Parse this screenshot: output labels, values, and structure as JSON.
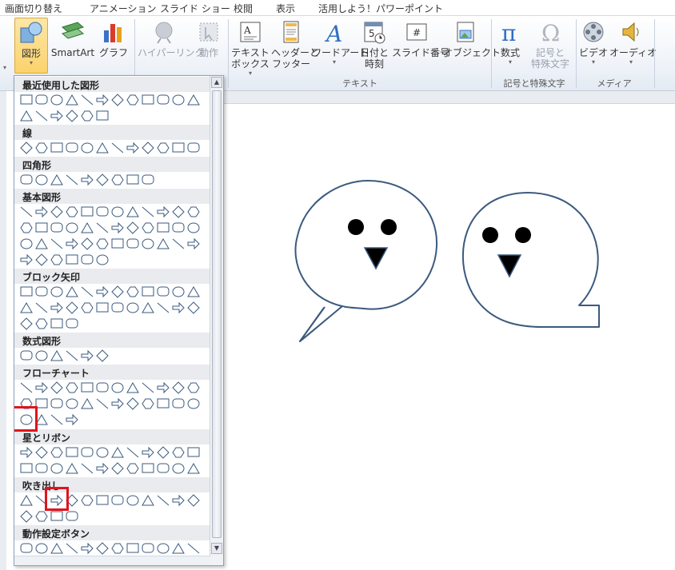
{
  "tabs": [
    "画面切り替え",
    "アニメーション",
    "スライド ショー",
    "校閲",
    "表示",
    "活用しよう！パワーポイント"
  ],
  "ribbon": {
    "buttons": [
      {
        "label": "図形",
        "icon": "shapes-icon",
        "active": true,
        "caret": true
      },
      {
        "label": "SmartArt",
        "icon": "smartart-icon"
      },
      {
        "label": "グラフ",
        "icon": "chart-icon"
      },
      {
        "label": "ハイパーリンク",
        "icon": "hyperlink-icon",
        "disabled": true
      },
      {
        "label": "動作",
        "icon": "action-icon",
        "disabled": true
      },
      {
        "label": "テキスト\nボックス",
        "icon": "textbox-icon",
        "caret": true
      },
      {
        "label": "ヘッダーと\nフッター",
        "icon": "header-footer-icon"
      },
      {
        "label": "ワードアート",
        "icon": "wordart-icon",
        "caret": true
      },
      {
        "label": "日付と\n時刻",
        "icon": "datetime-icon"
      },
      {
        "label": "スライド番号",
        "icon": "slide-number-icon"
      },
      {
        "label": "オブジェクト",
        "icon": "object-icon"
      },
      {
        "label": "数式",
        "icon": "equation-icon",
        "caret": true
      },
      {
        "label": "記号と\n特殊文字",
        "icon": "symbol-icon",
        "disabled": true
      },
      {
        "label": "ビデオ",
        "icon": "video-icon",
        "caret": true
      },
      {
        "label": "オーディオ",
        "icon": "audio-icon",
        "caret": true
      }
    ],
    "groups": {
      "text": "テキスト",
      "symbols": "記号と特殊文字",
      "media": "メディア"
    }
  },
  "gallery": {
    "sections": [
      "最近使用した図形",
      "線",
      "四角形",
      "基本図形",
      "ブロック矢印",
      "数式図形",
      "フローチャート",
      "星とリボン",
      "吹き出し",
      "動作設定ボタン"
    ]
  },
  "colors": {
    "outline": "#3b5a7d",
    "highlight": "#e0141e",
    "accent": "#fbd26b"
  }
}
